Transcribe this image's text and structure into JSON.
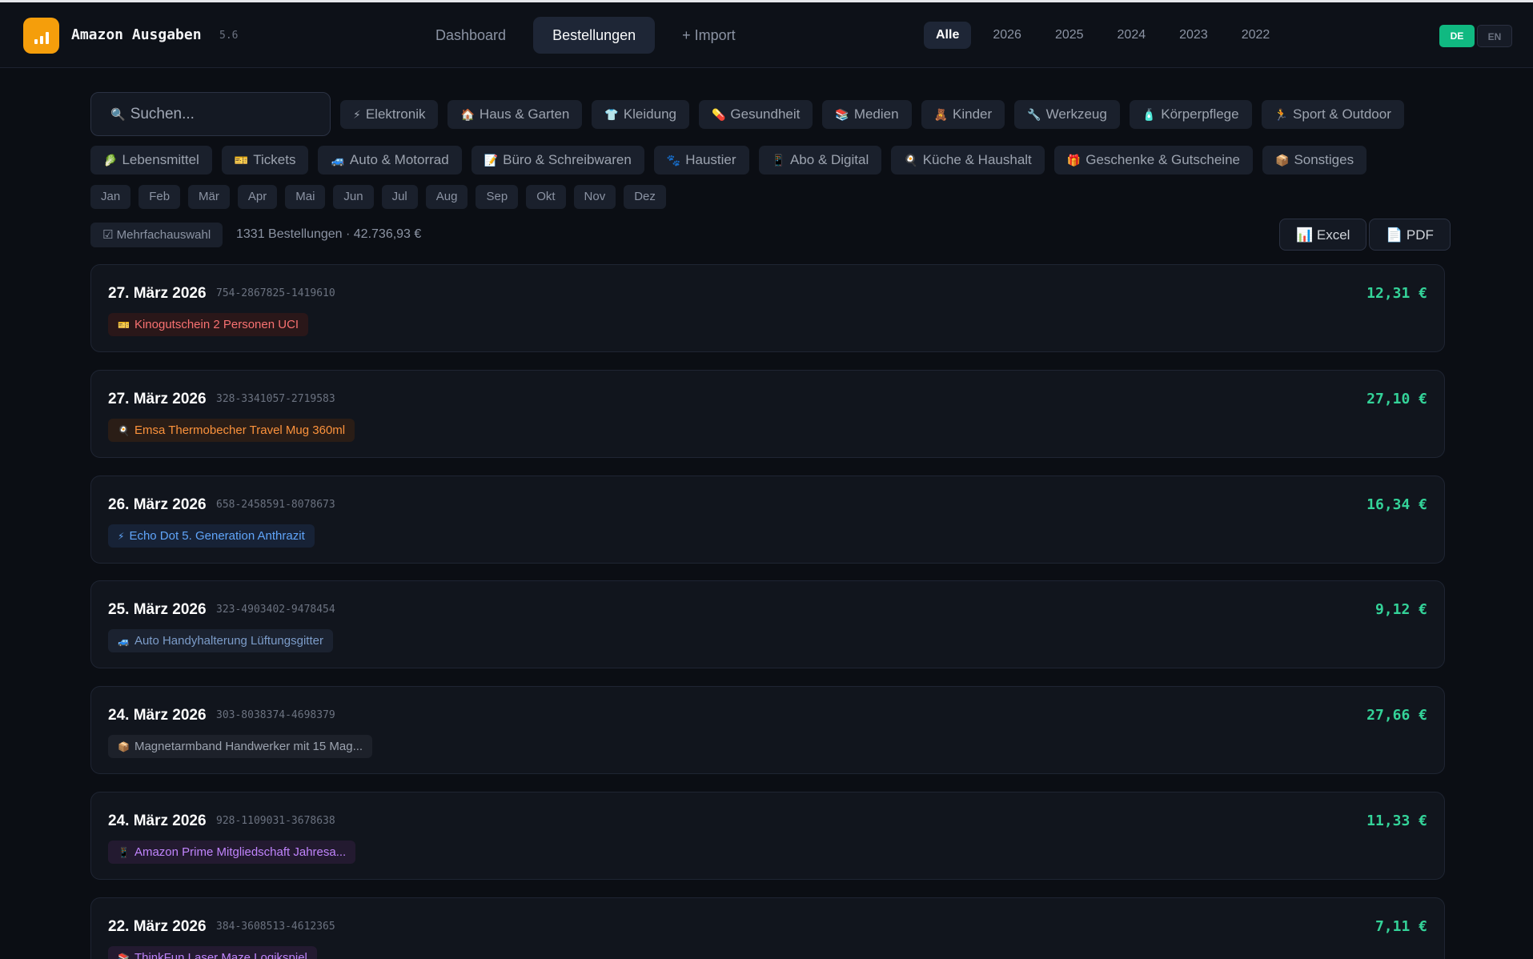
{
  "app": {
    "title": "Amazon Ausgaben",
    "version": "5.6"
  },
  "nav": {
    "dashboard": "Dashboard",
    "orders": "Bestellungen",
    "import": "+ Import"
  },
  "years": [
    "Alle",
    "2026",
    "2025",
    "2024",
    "2023",
    "2022"
  ],
  "lang": {
    "de": "DE",
    "en": "EN"
  },
  "search": {
    "placeholder": "Suchen...",
    "icon": "🔍"
  },
  "categories_row1": [
    {
      "icon": "⚡",
      "label": "Elektronik"
    },
    {
      "icon": "🏠",
      "label": "Haus & Garten"
    },
    {
      "icon": "👕",
      "label": "Kleidung"
    },
    {
      "icon": "💊",
      "label": "Gesundheit"
    },
    {
      "icon": "📚",
      "label": "Medien"
    },
    {
      "icon": "🧸",
      "label": "Kinder"
    },
    {
      "icon": "🔧",
      "label": "Werkzeug"
    },
    {
      "icon": "🧴",
      "label": "Körperpflege"
    },
    {
      "icon": "🏃",
      "label": "Sport & Outdoor"
    }
  ],
  "categories_row2": [
    {
      "icon": "🥬",
      "label": "Lebensmittel"
    },
    {
      "icon": "🎫",
      "label": "Tickets"
    },
    {
      "icon": "🚙",
      "label": "Auto & Motorrad"
    },
    {
      "icon": "📝",
      "label": "Büro & Schreibwaren"
    },
    {
      "icon": "🐾",
      "label": "Haustier"
    },
    {
      "icon": "📱",
      "label": "Abo & Digital"
    },
    {
      "icon": "🍳",
      "label": "Küche & Haushalt"
    },
    {
      "icon": "🎁",
      "label": "Geschenke & Gutscheine"
    },
    {
      "icon": "📦",
      "label": "Sonstiges"
    }
  ],
  "months": [
    "Jan",
    "Feb",
    "Mär",
    "Apr",
    "Mai",
    "Jun",
    "Jul",
    "Aug",
    "Sep",
    "Okt",
    "Nov",
    "Dez"
  ],
  "toolbar": {
    "multi": "☑ Mehrfachauswahl",
    "summary": "1331 Bestellungen · 42.736,93 €",
    "excel": "📊 Excel",
    "pdf": "📄 PDF"
  },
  "orders": [
    {
      "date": "27. März 2026",
      "id": "754-2867825-1419610",
      "amount": "12,31 €",
      "icon": "🎫",
      "item": "Kinogutschein 2 Personen UCI",
      "color": "#f87171",
      "bg": "#2a1719"
    },
    {
      "date": "27. März 2026",
      "id": "328-3341057-2719583",
      "amount": "27,10 €",
      "icon": "🍳",
      "item": "Emsa Thermobecher Travel Mug 360ml",
      "color": "#fb923c",
      "bg": "#2a1d16"
    },
    {
      "date": "26. März 2026",
      "id": "658-2458591-8078673",
      "amount": "16,34 €",
      "icon": "⚡",
      "item": "Echo Dot 5. Generation Anthrazit",
      "color": "#60a5fa",
      "bg": "#172236"
    },
    {
      "date": "25. März 2026",
      "id": "323-4903402-9478454",
      "amount": "9,12 €",
      "icon": "🚙",
      "item": "Auto Handyhalterung Lüftungsgitter",
      "color": "#7c9cc9",
      "bg": "#1b2230"
    },
    {
      "date": "24. März 2026",
      "id": "303-8038374-4698379",
      "amount": "27,66 €",
      "icon": "📦",
      "item": "Magnetarmband Handwerker mit 15 Mag...",
      "color": "#9ca3af",
      "bg": "#1d212a"
    },
    {
      "date": "24. März 2026",
      "id": "928-1109031-3678638",
      "amount": "11,33 €",
      "icon": "📱",
      "item": "Amazon Prime Mitgliedschaft Jahresa...",
      "color": "#c084fc",
      "bg": "#231a30"
    },
    {
      "date": "22. März 2026",
      "id": "384-3608513-4612365",
      "amount": "7,11 €",
      "icon": "📚",
      "item": "ThinkFun Laser Maze Logikspiel",
      "color": "#c084fc",
      "bg": "#231a30"
    }
  ]
}
